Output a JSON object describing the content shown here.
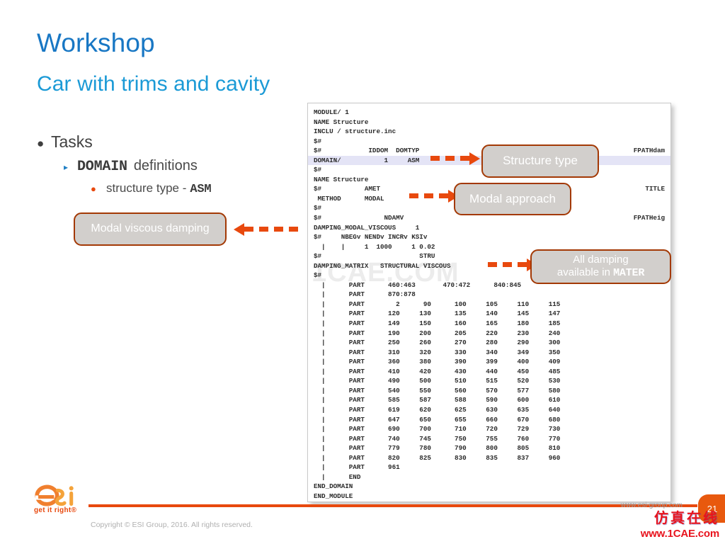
{
  "slide": {
    "title": "Workshop",
    "subtitle": "Car with trims and cavity",
    "page_number": "21",
    "colors": {
      "title_blue": "#1877c4",
      "subtitle_blue": "#1b9ad6",
      "accent_orange": "#e8490e",
      "callout_fill": "#d2cfcc",
      "callout_border": "#a33905",
      "highlight_row": "#e4e4f6"
    }
  },
  "bullets": {
    "level1": "Tasks",
    "level2_code": "DOMAIN",
    "level2_text": "definitions",
    "level3_text": "structure type -",
    "level3_code": "ASM"
  },
  "callouts": {
    "structure_type": "Structure type",
    "modal_approach": "Modal approach",
    "all_damping_line1": "All damping",
    "all_damping_line2_text": "available in",
    "all_damping_line2_code": "MATER",
    "modal_viscous": "Modal viscous damping"
  },
  "code_watermark": "1CAE.COM",
  "code_lines": [
    {
      "text": "MODULE/ 1",
      "right": "",
      "hl": false
    },
    {
      "text": "NAME Structure",
      "right": "",
      "hl": false
    },
    {
      "text": "INCLU / structure.inc",
      "right": "",
      "hl": false
    },
    {
      "text": "$#",
      "right": "",
      "hl": false
    },
    {
      "text": "$#            IDDOM  DOMTYP",
      "right": "FPATHdam",
      "hl": false
    },
    {
      "text": "DOMAIN/           1     ASM",
      "right": "",
      "hl": true
    },
    {
      "text": "$#",
      "right": "",
      "hl": false
    },
    {
      "text": "NAME Structure",
      "right": "",
      "hl": false
    },
    {
      "text": "$#           AMET",
      "right": "TITLE",
      "hl": false
    },
    {
      "text": " METHOD      MODAL",
      "right": "",
      "hl": false
    },
    {
      "text": "$#",
      "right": "",
      "hl": false
    },
    {
      "text": "$#                NDAMV",
      "right": "FPATHeig",
      "hl": false
    },
    {
      "text": "DAMPING_MODAL_VISCOUS     1",
      "right": "",
      "hl": false
    },
    {
      "text": "$#     NBEGv NENDv INCRv KSIv",
      "right": "",
      "hl": false
    },
    {
      "text": "  |    |     1  1000     1 0.02",
      "right": "",
      "hl": false
    },
    {
      "text": "$#                         STRU",
      "right": "",
      "hl": false
    },
    {
      "text": "DAMPING_MATRIX   STRUCTURAL VISCOUS",
      "right": "",
      "hl": false
    },
    {
      "text": "$#",
      "right": "",
      "hl": false
    },
    {
      "text": "  |      PART      460:463       470:472      840:845",
      "right": "",
      "hl": false
    },
    {
      "text": "  |      PART      870:878",
      "right": "",
      "hl": false
    },
    {
      "text": "  |      PART        2      90      100     105     110     115",
      "right": "",
      "hl": false
    },
    {
      "text": "  |      PART      120     130      135     140     145     147",
      "right": "",
      "hl": false
    },
    {
      "text": "  |      PART      149     150      160     165     180     185",
      "right": "",
      "hl": false
    },
    {
      "text": "  |      PART      190     200      205     220     230     240",
      "right": "",
      "hl": false
    },
    {
      "text": "  |      PART      250     260      270     280     290     300",
      "right": "",
      "hl": false
    },
    {
      "text": "  |      PART      310     320      330     340     349     350",
      "right": "",
      "hl": false
    },
    {
      "text": "  |      PART      360     380      390     399     400     409",
      "right": "",
      "hl": false
    },
    {
      "text": "  |      PART      410     420      430     440     450     485",
      "right": "",
      "hl": false
    },
    {
      "text": "  |      PART      490     500      510     515     520     530",
      "right": "",
      "hl": false
    },
    {
      "text": "  |      PART      540     550      560     570     577     580",
      "right": "",
      "hl": false
    },
    {
      "text": "  |      PART      585     587      588     590     600     610",
      "right": "",
      "hl": false
    },
    {
      "text": "  |      PART      619     620      625     630     635     640",
      "right": "",
      "hl": false
    },
    {
      "text": "  |      PART      647     650      655     660     670     680",
      "right": "",
      "hl": false
    },
    {
      "text": "  |      PART      690     700      710     720     729     730",
      "right": "",
      "hl": false
    },
    {
      "text": "  |      PART      740     745      750     755     760     770",
      "right": "",
      "hl": false
    },
    {
      "text": "  |      PART      779     780      790     800     805     810",
      "right": "",
      "hl": false
    },
    {
      "text": "  |      PART      820     825      830     835     837     960",
      "right": "",
      "hl": false
    },
    {
      "text": "  |      PART      961",
      "right": "",
      "hl": false
    },
    {
      "text": "  |      END",
      "right": "",
      "hl": false
    },
    {
      "text": "END_DOMAIN",
      "right": "",
      "hl": false
    },
    {
      "text": "END_MODULE",
      "right": "",
      "hl": false
    }
  ],
  "footer": {
    "logo_tagline": "get it right®",
    "copyright": "Copyright © ESI Group, 2016. All rights reserved.",
    "esi_url": "www.esi-group.com"
  },
  "watermark": {
    "chinese": "仿真在线",
    "url": "www.1CAE.com"
  }
}
